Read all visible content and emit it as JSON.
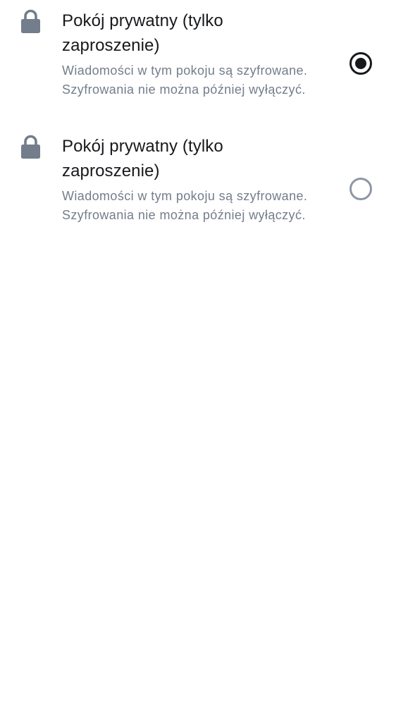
{
  "options": [
    {
      "title": "Pokój prywatny (tylko zaproszenie)",
      "description": "Wiadomości w tym pokoju są szyfrowane. Szyfrowania nie można później wyłączyć.",
      "icon": "lock-icon",
      "selected": true
    },
    {
      "title": "Pokój prywatny (tylko zaproszenie)",
      "description": "Wiadomości w tym pokoju są szyfrowane. Szyfrowania nie można później wyłączyć.",
      "icon": "lock-icon",
      "selected": false
    }
  ],
  "colors": {
    "title": "#17191c",
    "description": "#737d8c",
    "icon": "#737d8c",
    "radio_checked": "#17191c",
    "radio_unchecked": "#8d97a5"
  }
}
